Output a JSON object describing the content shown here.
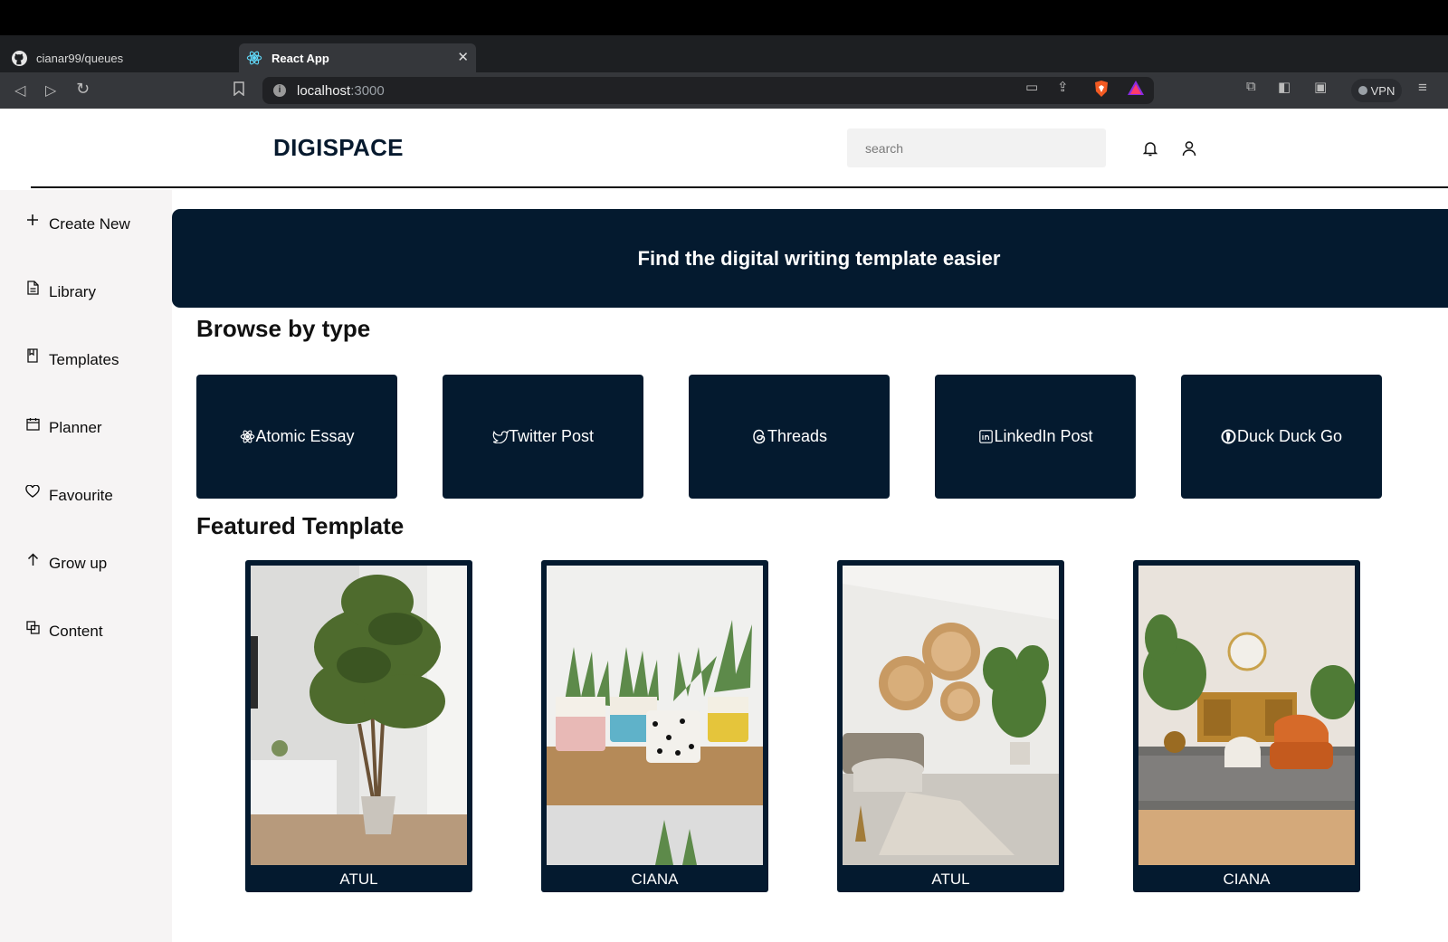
{
  "browser": {
    "tabs": [
      {
        "title": "cianar99/queues",
        "icon": "github-icon"
      },
      {
        "title": "React App",
        "icon": "react-icon"
      }
    ],
    "url_host": "localhost",
    "url_port": ":3000",
    "vpn_label": "VPN"
  },
  "app": {
    "brand": "DIGISPACE",
    "search_placeholder": "search"
  },
  "sidebar": {
    "items": [
      {
        "label": "Create New",
        "icon": "plus-icon"
      },
      {
        "label": "Library",
        "icon": "document-icon"
      },
      {
        "label": "Templates",
        "icon": "bookmark-icon"
      },
      {
        "label": "Planner",
        "icon": "calendar-icon"
      },
      {
        "label": "Favourite",
        "icon": "heart-icon"
      },
      {
        "label": "Grow up",
        "icon": "arrow-up-icon"
      },
      {
        "label": "Content",
        "icon": "copy-icon"
      }
    ]
  },
  "hero": {
    "text": "Find the digital writing template easier"
  },
  "browse": {
    "title": "Browse by type",
    "types": [
      {
        "label": "Atomic Essay",
        "icon": "atom-icon"
      },
      {
        "label": "Twitter Post",
        "icon": "twitter-icon"
      },
      {
        "label": "Threads",
        "icon": "threads-icon"
      },
      {
        "label": "LinkedIn Post",
        "icon": "linkedin-icon"
      },
      {
        "label": "Duck Duck Go",
        "icon": "duckduckgo-icon"
      }
    ]
  },
  "featured": {
    "title": "Featured Template",
    "cards": [
      {
        "author": "ATUL",
        "image": "palm-plant-photo"
      },
      {
        "author": "CIANA",
        "image": "succulent-pots-photo"
      },
      {
        "author": "ATUL",
        "image": "living-room-wall-baskets-photo"
      },
      {
        "author": "CIANA",
        "image": "living-room-orange-chair-photo"
      }
    ]
  },
  "colors": {
    "navy": "#041a2f",
    "sidebar_bg": "#f6f4f4",
    "brand_text": "#071a2e"
  }
}
